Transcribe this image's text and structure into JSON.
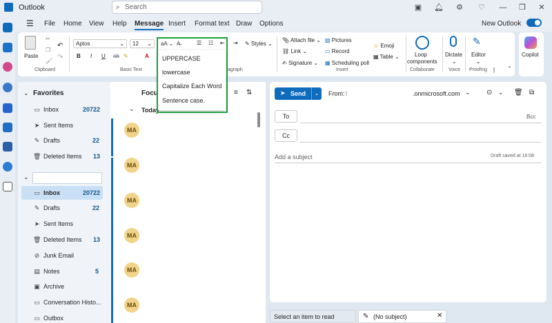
{
  "app": {
    "title": "Outlook"
  },
  "search": {
    "placeholder": "Search"
  },
  "menu": {
    "tabs": [
      "File",
      "Home",
      "View",
      "Help",
      "Message",
      "Insert",
      "Format text",
      "Draw",
      "Options"
    ],
    "active": "Message",
    "new_outlook_label": "New Outlook"
  },
  "ribbon": {
    "clipboard": {
      "paste_label": "Paste",
      "group_label": "Clipboard"
    },
    "basic_text": {
      "font_name": "Aptos",
      "font_size": "12",
      "group_label": "Basic Text",
      "case_button": "aA",
      "styles_label": "Styles"
    },
    "paragraph_group_label": "agraph",
    "insert": {
      "attach_label": "Attach file",
      "link_label": "Link",
      "signature_label": "Signature",
      "pictures_label": "Pictures",
      "record_label": "Record",
      "scheduling_label": "Scheduling poll",
      "emoji_label": "Emoji",
      "table_label": "Table",
      "group_label": "Insert"
    },
    "collaborate": {
      "loop_line1": "Loop",
      "loop_line2": "components",
      "group_label": "Collaborate"
    },
    "voice": {
      "dictate_label": "Dictate",
      "group_label": "Voice"
    },
    "proofing": {
      "editor_label": "Editor",
      "group_label": "Proofing"
    },
    "copilot_label": "Copilot"
  },
  "case_menu": {
    "items": [
      "UPPERCASE",
      "lowercase",
      "Capitalize Each Word",
      "Sentence case."
    ]
  },
  "folders": {
    "favorites_label": "Favorites",
    "favorites": [
      {
        "name": "Inbox",
        "count": "20722"
      },
      {
        "name": "Sent Items",
        "count": ""
      },
      {
        "name": "Drafts",
        "count": "22"
      },
      {
        "name": "Deleted Items",
        "count": "13"
      }
    ],
    "account": [
      {
        "name": "Inbox",
        "count": "20722"
      },
      {
        "name": "Drafts",
        "count": "22"
      },
      {
        "name": "Sent Items",
        "count": ""
      },
      {
        "name": "Deleted Items",
        "count": "13"
      },
      {
        "name": "Junk Email",
        "count": ""
      },
      {
        "name": "Notes",
        "count": "5"
      },
      {
        "name": "Archive",
        "count": ""
      },
      {
        "name": "Conversation Histo...",
        "count": ""
      },
      {
        "name": "Outbox",
        "count": ""
      }
    ]
  },
  "message_list": {
    "focused_tab": "Focu",
    "group_label": "Today",
    "avatar_initials": "MA"
  },
  "compose": {
    "send_label": "Send",
    "from_label": "From:",
    "from_prefix": "l",
    "from_domain": ".onmicrosoft.com",
    "to_label": "To",
    "cc_label": "Cc",
    "bcc_label": "Bcc",
    "subject_placeholder": "Add a subject",
    "draft_status": "Draft saved at 16:08"
  },
  "bottom": {
    "select_item": "Select an item to read",
    "no_subject": "(No subject)"
  }
}
